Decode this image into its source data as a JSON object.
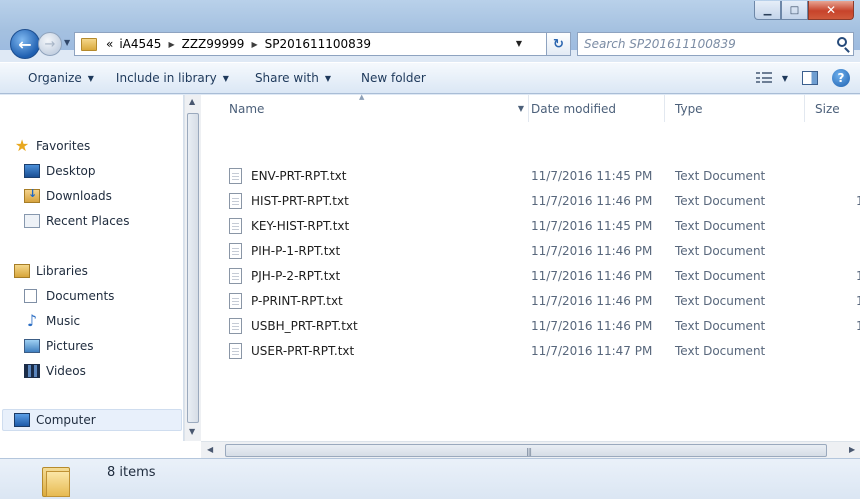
{
  "address": {
    "overflow": "«",
    "crumbs": [
      "iA4545",
      "ZZZ99999",
      "SP201611100839"
    ]
  },
  "search": {
    "placeholder": "Search SP201611100839"
  },
  "toolbar": {
    "organize": "Organize",
    "include": "Include in library",
    "share": "Share with",
    "new_folder": "New folder"
  },
  "nav": {
    "favorites": "Favorites",
    "desktop": "Desktop",
    "downloads": "Downloads",
    "recent": "Recent Places",
    "libraries": "Libraries",
    "documents": "Documents",
    "music": "Music",
    "pictures": "Pictures",
    "videos": "Videos",
    "computer": "Computer"
  },
  "columns": {
    "name": "Name",
    "date": "Date modified",
    "type": "Type",
    "size": "Size"
  },
  "files": [
    {
      "name": "ENV-PRT-RPT.txt",
      "date": "11/7/2016 11:45 PM",
      "type": "Text Document",
      "size": ""
    },
    {
      "name": "HIST-PRT-RPT.txt",
      "date": "11/7/2016 11:46 PM",
      "type": "Text Document",
      "size": "1"
    },
    {
      "name": "KEY-HIST-RPT.txt",
      "date": "11/7/2016 11:45 PM",
      "type": "Text Document",
      "size": ""
    },
    {
      "name": "PIH-P-1-RPT.txt",
      "date": "11/7/2016 11:46 PM",
      "type": "Text Document",
      "size": ""
    },
    {
      "name": "PJH-P-2-RPT.txt",
      "date": "11/7/2016 11:46 PM",
      "type": "Text Document",
      "size": "1"
    },
    {
      "name": "P-PRINT-RPT.txt",
      "date": "11/7/2016 11:46 PM",
      "type": "Text Document",
      "size": "1"
    },
    {
      "name": "USBH_PRT-RPT.txt",
      "date": "11/7/2016 11:46 PM",
      "type": "Text Document",
      "size": "1"
    },
    {
      "name": "USER-PRT-RPT.txt",
      "date": "11/7/2016 11:47 PM",
      "type": "Text Document",
      "size": ""
    }
  ],
  "status": {
    "item_count": "8 items"
  }
}
